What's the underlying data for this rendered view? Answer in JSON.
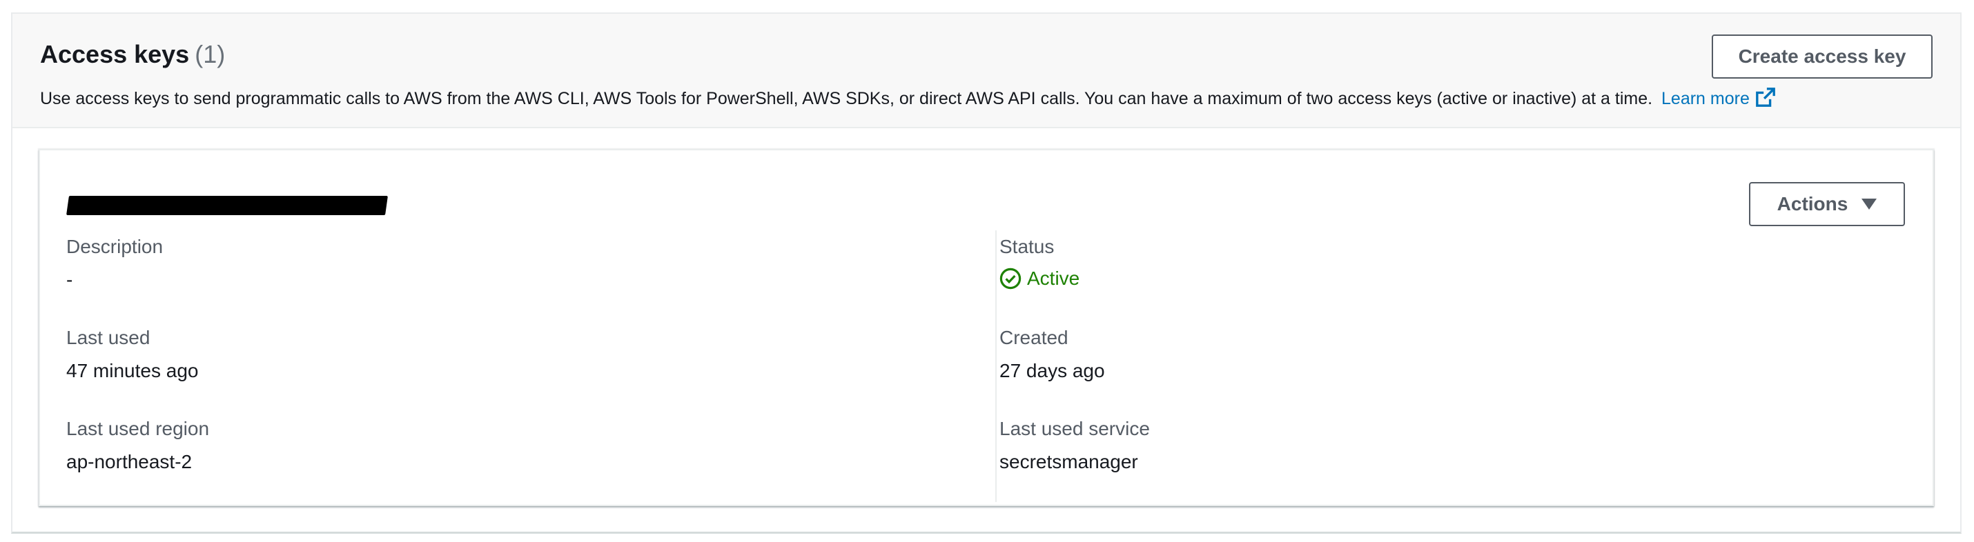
{
  "header": {
    "title": "Access keys",
    "count": "(1)",
    "description": "Use access keys to send programmatic calls to AWS from the AWS CLI, AWS Tools for PowerShell, AWS SDKs, or direct AWS API calls. You can have a maximum of two access keys (active or inactive) at a time.",
    "learn_more": "Learn more",
    "external_icon": "external-link-icon",
    "create_button": "Create access key"
  },
  "key": {
    "actions_button": "Actions",
    "actions_icon": "caret-down-icon",
    "fields": {
      "description": {
        "label": "Description",
        "value": "-"
      },
      "last_used": {
        "label": "Last used",
        "value": "47 minutes ago"
      },
      "last_used_region": {
        "label": "Last used region",
        "value": "ap-northeast-2"
      },
      "status": {
        "label": "Status",
        "value": "Active",
        "icon": "check-circle-icon"
      },
      "created": {
        "label": "Created",
        "value": "27 days ago"
      },
      "last_used_service": {
        "label": "Last used service",
        "value": "secretsmanager"
      }
    }
  },
  "colors": {
    "link": "#0073bb",
    "status_active": "#1d8102",
    "button_border": "#545b64",
    "header_bg": "#f8f8f8"
  }
}
